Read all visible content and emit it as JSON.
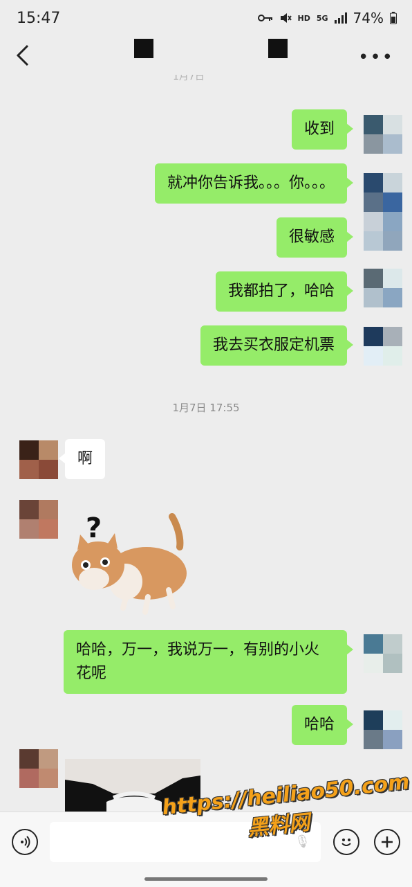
{
  "status_bar": {
    "time": "15:47",
    "hd": "HD",
    "net": "5G",
    "battery": "74%"
  },
  "header": {
    "back_icon": "chevron-left-icon",
    "more_icon": "ellipsis-icon",
    "title_redacted": true
  },
  "chat": {
    "timestamp_1": "1月7日 17:55",
    "messages": [
      {
        "side": "me",
        "text": "收到"
      },
      {
        "side": "me",
        "text": "就冲你告诉我。。。你。。。"
      },
      {
        "side": "me",
        "text": "很敏感"
      },
      {
        "side": "me",
        "text": "我都拍了，哈哈"
      },
      {
        "side": "me",
        "text": "我去买衣服定机票"
      },
      {
        "side": "other",
        "text": "啊"
      },
      {
        "side": "other",
        "sticker": "confused-cat-sticker"
      },
      {
        "side": "me",
        "text_line1": "哈哈，万一，我说万一，有别的小火",
        "text_line2": "花呢"
      },
      {
        "side": "me",
        "text": "哈哈"
      },
      {
        "side": "other",
        "image": "cat-photo"
      }
    ]
  },
  "input_bar": {
    "voice_icon": "voice-icon",
    "emoji_icon": "emoji-icon",
    "plus_icon": "plus-icon"
  },
  "watermark": {
    "line1": "https://heiliao50.com",
    "line2": "黑料网"
  },
  "colors": {
    "my_bubble": "#95ec69",
    "their_bubble": "#ffffff",
    "background": "#ededed"
  }
}
